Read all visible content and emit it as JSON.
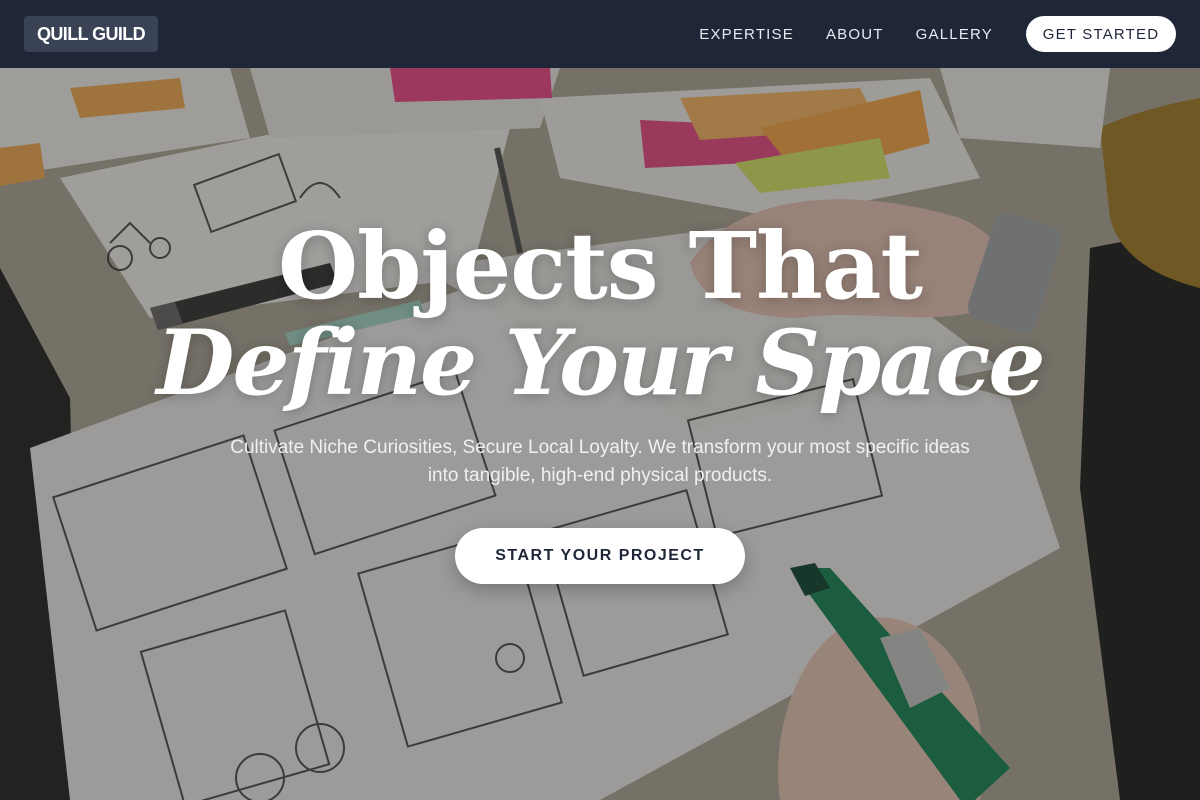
{
  "brand": {
    "name": "QUILL GUILD"
  },
  "nav": {
    "links": [
      "EXPERTISE",
      "ABOUT",
      "GALLERY"
    ],
    "cta_label": "GET STARTED"
  },
  "hero": {
    "title_line1": "Objects That",
    "title_line2": "Define Your Space",
    "subtitle_line1": "Cultivate Niche Curiosities, Secure Local Loyalty. We transform your most specific ideas",
    "subtitle_line2": "into tangible, high-end physical products.",
    "cta_label": "START YOUR PROJECT"
  },
  "colors": {
    "header_bg": "#1e2638",
    "brand_chip": "#3a4356",
    "button_bg": "#ffffff",
    "button_text": "#1e2638",
    "sticky_orange": "#f3a94a",
    "sticky_pink": "#e8477e",
    "marker_green": "#1f8a57"
  }
}
